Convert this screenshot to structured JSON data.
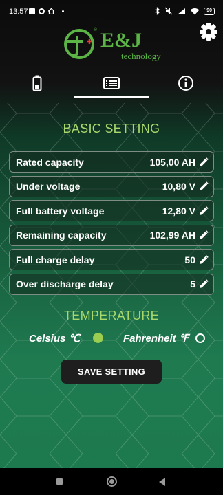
{
  "status_bar": {
    "time": "13:57",
    "battery": "90"
  },
  "header": {
    "brand": "E&J",
    "brand_sub": "technology",
    "logo_mark": "J",
    "logo_registered": "®"
  },
  "tabs": [
    {
      "name": "battery-icon",
      "active": false
    },
    {
      "name": "list-icon",
      "active": true
    },
    {
      "name": "info-icon",
      "active": false
    }
  ],
  "basic_setting": {
    "title": "BASIC SETTING",
    "rows": [
      {
        "label": "Rated capacity",
        "value": "105,00 AH"
      },
      {
        "label": "Under voltage",
        "value": "10,80 V"
      },
      {
        "label": "Full battery voltage",
        "value": "12,80 V"
      },
      {
        "label": "Remaining capacity",
        "value": "102,99 AH"
      },
      {
        "label": "Full charge delay",
        "value": "50"
      },
      {
        "label": "Over discharge delay",
        "value": "5"
      }
    ]
  },
  "temperature": {
    "title": "TEMPERATURE",
    "celsius_label": "Celsius ℃",
    "fahrenheit_label": "Fahrenheit ℉",
    "selected": "celsius"
  },
  "save_button": {
    "label": "SAVE SETTING"
  },
  "colors": {
    "accent_green": "#a9d86b",
    "brand_green": "#5bb445",
    "logo_red": "#e53935",
    "radio_selected": "#9acd50"
  }
}
